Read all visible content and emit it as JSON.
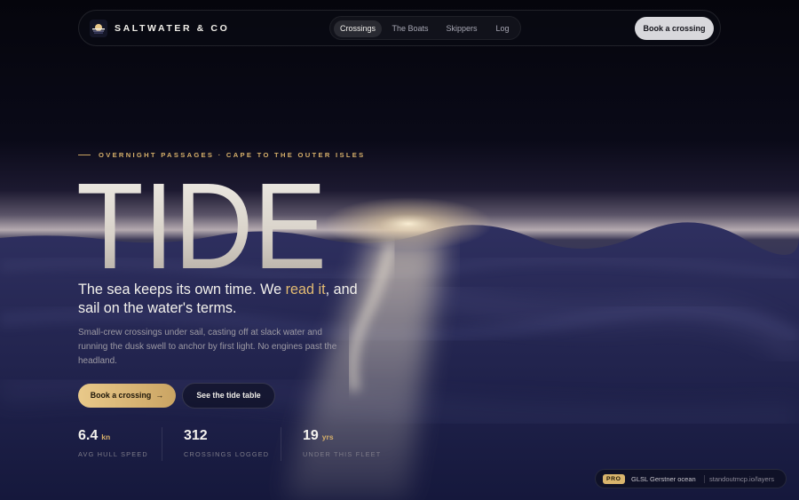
{
  "brand": {
    "name": "SALTWATER & CO",
    "logo_icon": "sun-over-water-icon"
  },
  "nav": {
    "links": [
      {
        "label": "Crossings",
        "active": true
      },
      {
        "label": "The Boats",
        "active": false
      },
      {
        "label": "Skippers",
        "active": false
      },
      {
        "label": "Log",
        "active": false
      }
    ],
    "cta_label": "Book a crossing"
  },
  "hero": {
    "eyebrow": "OVERNIGHT PASSAGES · CAPE TO THE OUTER ISLES",
    "title": "TIDE",
    "headline_before": "The sea keeps its own time. We ",
    "headline_accent": "read it",
    "headline_after": ", and sail on the water's terms.",
    "body": "Small-crew crossings under sail, casting off at slack water and running the dusk swell to anchor by first light. No engines past the headland.",
    "primary_button": "Book a crossing",
    "primary_button_icon": "arrow-right-icon",
    "secondary_button": "See the tide table"
  },
  "stats": [
    {
      "value": "6.4",
      "unit": "kn",
      "label": "AVG HULL SPEED"
    },
    {
      "value": "312",
      "unit": "",
      "label": "CROSSINGS LOGGED"
    },
    {
      "value": "19",
      "unit": "yrs",
      "label": "UNDER THIS FLEET"
    }
  ],
  "badge": {
    "tag": "PRO",
    "label": "GLSL Gerstner ocean",
    "link": "standoutmcp.io/layers"
  },
  "colors": {
    "accent_gold": "#d7b06a",
    "background": "#05060d",
    "ocean": "#2a2b57",
    "nav_cta": "#d8d8dc"
  }
}
